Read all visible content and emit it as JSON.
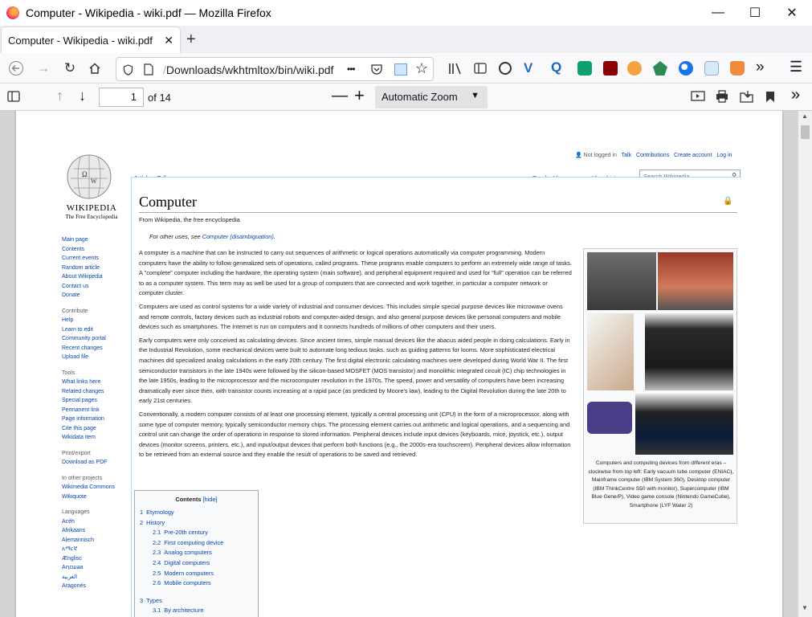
{
  "window": {
    "title": "Computer - Wikipedia - wiki.pdf — Mozilla Firefox"
  },
  "tab": {
    "title": "Computer - Wikipedia - wiki.pdf"
  },
  "urlbar": {
    "url_prefix": "/",
    "url": "Downloads/wkhtmltox/bin/wiki.pdf",
    "more": "•••"
  },
  "pdf": {
    "page_number": "1",
    "page_count": "of 14",
    "zoom": "Automatic Zoom"
  },
  "wiki": {
    "logo_title": "WIKIPEDIA",
    "logo_sub": "The Free Encyclopedia",
    "personal": [
      "Not logged in",
      "Talk",
      "Contributions",
      "Create account",
      "Log in"
    ],
    "tabs_left": [
      "Article",
      "Talk"
    ],
    "tabs_right": [
      "Read",
      "View source",
      "View history"
    ],
    "search_placeholder": "Search Wikipedia",
    "heading": "Computer",
    "subtitle": "From Wikipedia, the free encyclopedia",
    "hatnote_pre": "For other uses, see ",
    "hatnote_link": "Computer (disambiguation)",
    "hatnote_post": ".",
    "nav": [
      "Main page",
      "Contents",
      "Current events",
      "Random article",
      "About Wikipedia",
      "Contact us",
      "Donate"
    ],
    "contribute_heading": "Contribute",
    "contribute": [
      "Help",
      "Learn to edit",
      "Community portal",
      "Recent changes",
      "Upload file"
    ],
    "tools_heading": "Tools",
    "tools": [
      "What links here",
      "Related changes",
      "Special pages",
      "Permanent link",
      "Page information",
      "Cite this page",
      "Wikidata item"
    ],
    "print_heading": "Print/export",
    "print": [
      "Download as PDF"
    ],
    "other_heading": "In other projects",
    "other": [
      "Wikimedia Commons",
      "Wikiquote"
    ],
    "lang_heading": "Languages",
    "langs": [
      "Acèh",
      "Afrikaans",
      "Alemannisch",
      "አማርኛ",
      "Ænglisc",
      "Аԥсшәа",
      "العربية",
      "Aragonés"
    ],
    "paragraphs": [
      "A computer is a machine that can be instructed to carry out sequences of arithmetic or logical operations automatically via computer programming. Modern computers have the ability to follow generalized sets of operations, called programs. These programs enable computers to perform an extremely wide range of tasks. A \"complete\" computer including the hardware, the operating system (main software), and peripheral equipment required and used for \"full\" operation can be referred to as a computer system. This term may as well be used for a group of computers that are connected and work together, in particular a computer network or computer cluster.",
      "Computers are used as control systems for a wide variety of industrial and consumer devices. This includes simple special purpose devices like microwave ovens and remote controls, factory devices such as industrial robots and computer-aided design, and also general purpose devices like personal computers and mobile devices such as smartphones. The Internet is run on computers and it connects hundreds of millions of other computers and their users.",
      "Early computers were only conceived as calculating devices. Since ancient times, simple manual devices like the abacus aided people in doing calculations. Early in the Industrial Revolution, some mechanical devices were built to automate long tedious tasks, such as guiding patterns for looms. More sophisticated electrical machines did specialized analog calculations in the early 20th century. The first digital electronic calculating machines were developed during World War II. The first semiconductor transistors in the late 1940s were followed by the silicon-based MOSFET (MOS transistor) and monolithic integrated circuit (IC) chip technologies in the late 1950s, leading to the microprocessor and the microcomputer revolution in the 1970s. The speed, power and versatility of computers have been increasing dramatically ever since then, with transistor counts increasing at a rapid pace (as predicted by Moore's law), leading to the Digital Revolution during the late 20th to early 21st centuries.",
      "Conventionally, a modern computer consists of at least one processing element, typically a central processing unit (CPU) in the form of a microprocessor, along with some type of computer memory, typically semiconductor memory chips. The processing element carries out arithmetic and logical operations, and a sequencing and control unit can change the order of operations in response to stored information. Peripheral devices include input devices (keyboards, mice, joystick, etc.), output devices (monitor screens, printers, etc.), and input/output devices that perform both functions (e.g., the 2000s-era touchscreen). Peripheral devices allow information to be retrieved from an external source and they enable the result of operations to be saved and retrieved."
    ],
    "caption": "Computers and computing devices from different eras – clockwise from top left: Early vacuum tube computer (ENIAC), Mainframe computer (IBM System 360), Desktop computer (IBM ThinkCentre S50 with monitor), Supercomputer (IBM Blue Gene/P), Video game console (Nintendo GameCube), Smartphone (LYF Water 2)",
    "toc_title": "Contents",
    "toc_hide": "[hide]",
    "toc": [
      {
        "n": "1",
        "t": "Etymology",
        "level": 1
      },
      {
        "n": "2",
        "t": "History",
        "level": 1
      },
      {
        "n": "2.1",
        "t": "Pre-20th century",
        "level": 2
      },
      {
        "n": "2.2",
        "t": "First computing device",
        "level": 2
      },
      {
        "n": "2.3",
        "t": "Analog computers",
        "level": 2
      },
      {
        "n": "2.4",
        "t": "Digital computers",
        "level": 2
      },
      {
        "n": "2.5",
        "t": "Modern computers",
        "level": 2
      },
      {
        "n": "2.6",
        "t": "Mobile computers",
        "level": 2
      },
      {
        "n": "3",
        "t": "Types",
        "level": 1
      },
      {
        "n": "3.1",
        "t": "By architecture",
        "level": 2
      }
    ]
  }
}
